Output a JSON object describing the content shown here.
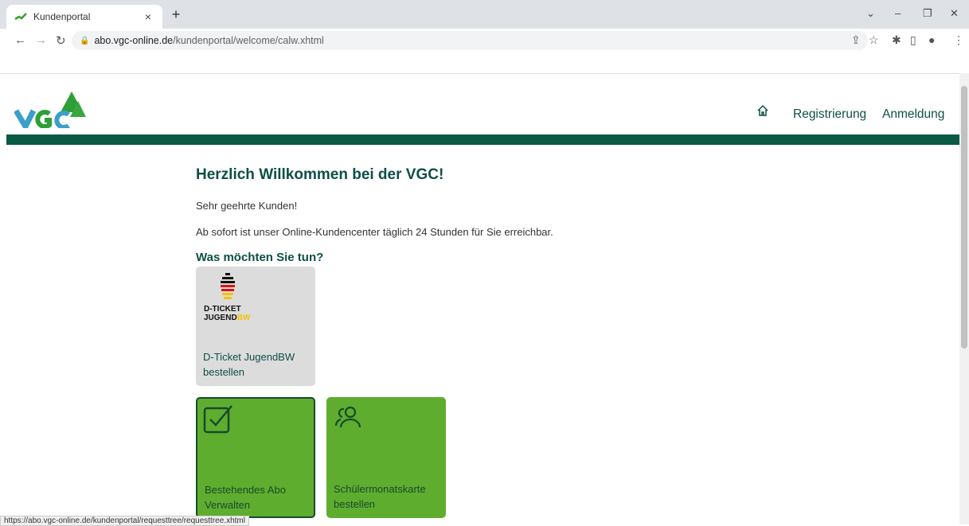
{
  "browser": {
    "tab_title": "Kundenportal",
    "tab_close": "×",
    "new_tab": "+",
    "url_host": "abo.vgc-online.de",
    "url_path": "/kundenportal/welcome/calw.xhtml",
    "status_url": "https://abo.vgc-online.de/kundenportal/requesttree/requesttree.xhtml"
  },
  "header": {
    "logo_text": "VGC",
    "home_icon": "home-icon",
    "nav": [
      "Registrierung",
      "Anmeldung"
    ]
  },
  "main": {
    "title": "Herzlich Willkommen bei der VGC!",
    "greeting": "Sehr geehrte Kunden!",
    "intro": "Ab sofort ist unser Online-Kundencenter täglich 24 Stunden für Sie erreichbar.",
    "question": "Was möchten Sie tun?",
    "tiles": [
      {
        "logo_line1": "D-TICKET",
        "logo_line2": "JUGEND",
        "logo_suffix": "BW",
        "label_line1": "D-Ticket JugendBW",
        "label_line2": "bestellen",
        "icon": "d-ticket-logo"
      },
      {
        "label_line1": "Bestehendes Abo",
        "label_line2": "Verwalten",
        "icon": "checkbox-icon"
      },
      {
        "label_line1": "Schülermonatskarte",
        "label_line2": "bestellen",
        "icon": "users-icon"
      }
    ]
  },
  "colors": {
    "brand_dark": "#0b5a45",
    "tile_green": "#5fad2f",
    "tile_grey": "#dcdcdc"
  }
}
